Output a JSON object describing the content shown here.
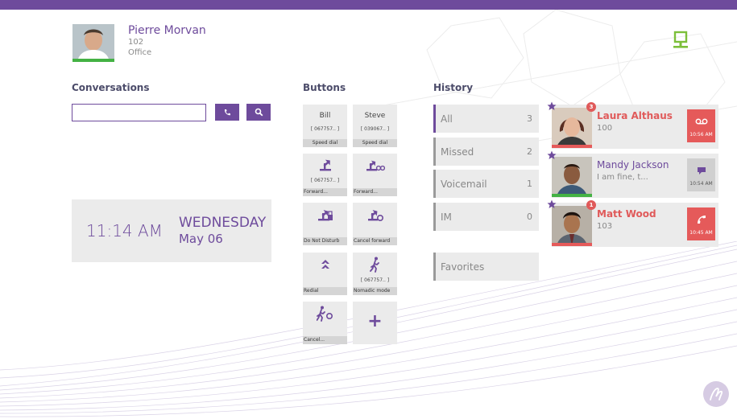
{
  "profile": {
    "name": "Pierre Morvan",
    "extension": "102",
    "location": "Office"
  },
  "conversations": {
    "title": "Conversations",
    "search_placeholder": "",
    "call_icon": "phone-icon",
    "search_icon": "magnifier-icon"
  },
  "clock": {
    "time": "11:14 AM",
    "day": "WEDNESDAY",
    "date": "May 06"
  },
  "buttons": {
    "title": "Buttons",
    "bill": {
      "name": "Bill",
      "number": "[ 067757.. ]",
      "label": "Speed dial"
    },
    "steve": {
      "name": "Steve",
      "number": "[ 039067.. ]",
      "label": "Speed dial"
    },
    "forward1": {
      "number": "[ 067757.. ]",
      "label": "Forward..."
    },
    "forward2": {
      "label": "Forward..."
    },
    "dnd": {
      "label": "Do Not Disturb"
    },
    "cancel_forward": {
      "label": "Cancel forward"
    },
    "redial": {
      "label": "Redial"
    },
    "nomadic": {
      "number": "[ 067757.. ]",
      "label": "Nomadic mode"
    },
    "cancel": {
      "label": "Cancel..."
    },
    "add": {
      "label": "+"
    }
  },
  "history": {
    "title": "History",
    "items": [
      {
        "label": "All",
        "count": "3"
      },
      {
        "label": "Missed",
        "count": "2"
      },
      {
        "label": "Voicemail",
        "count": "1"
      },
      {
        "label": "IM",
        "count": "0"
      }
    ],
    "favorites": "Favorites"
  },
  "contacts": [
    {
      "name": "Laura Althaus",
      "sub": "100",
      "badge": "3",
      "time": "10:56 AM",
      "action_icon": "voicemail-icon",
      "action_color": "#e55a5a"
    },
    {
      "name": "Mandy Jackson",
      "sub": "I am fine, t...",
      "badge": "",
      "time": "10:54 AM",
      "action_icon": "chat-icon",
      "action_color": "#d0d0d0"
    },
    {
      "name": "Matt Wood",
      "sub": "103",
      "badge": "1",
      "time": "10:45 AM",
      "action_icon": "phone-missed-icon",
      "action_color": "#e55a5a"
    }
  ],
  "colors": {
    "accent": "#6e4b9c",
    "missed": "#e55a5a",
    "presence_available": "#44b244",
    "desk_icon": "#7cbf3a"
  }
}
